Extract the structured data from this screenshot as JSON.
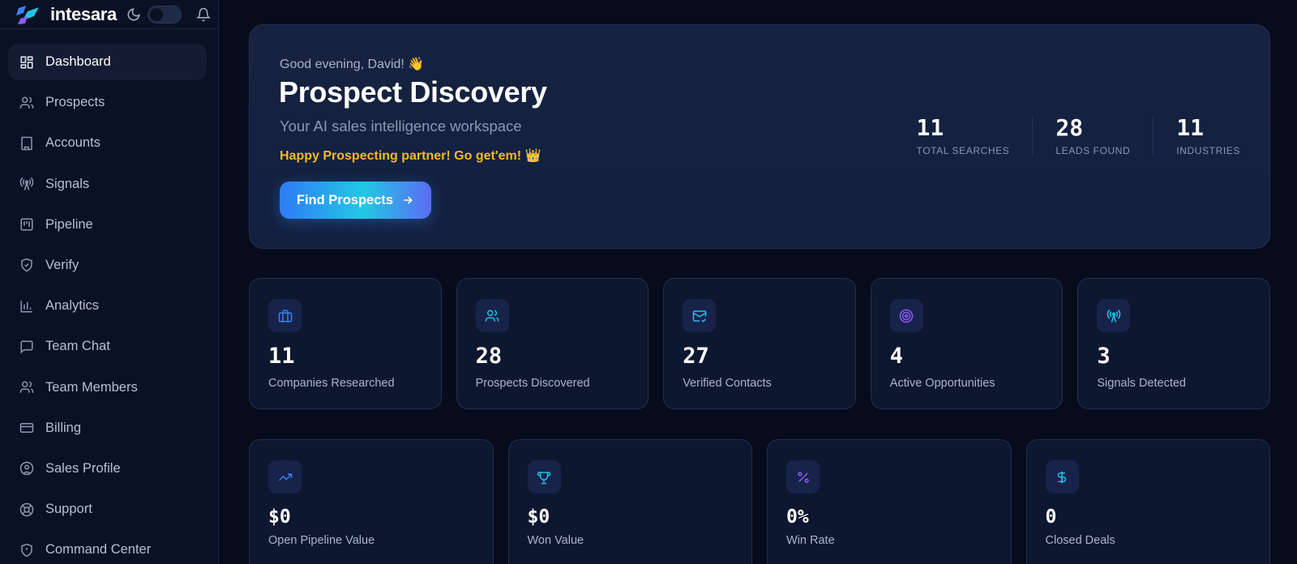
{
  "brand": {
    "name": "intesara"
  },
  "sidebar": {
    "items": [
      {
        "label": "Dashboard",
        "icon": "dashboard-icon",
        "active": true
      },
      {
        "label": "Prospects",
        "icon": "users-icon"
      },
      {
        "label": "Accounts",
        "icon": "building-icon"
      },
      {
        "label": "Signals",
        "icon": "radio-tower-icon"
      },
      {
        "label": "Pipeline",
        "icon": "kanban-icon"
      },
      {
        "label": "Verify",
        "icon": "shield-check-icon"
      },
      {
        "label": "Analytics",
        "icon": "bar-chart-icon"
      },
      {
        "label": "Team Chat",
        "icon": "message-icon"
      },
      {
        "label": "Team Members",
        "icon": "users-icon"
      },
      {
        "label": "Billing",
        "icon": "credit-card-icon"
      },
      {
        "label": "Sales Profile",
        "icon": "user-circle-icon"
      },
      {
        "label": "Support",
        "icon": "lifebuoy-icon"
      },
      {
        "label": "Command Center",
        "icon": "shield-alert-icon"
      }
    ]
  },
  "hero": {
    "greeting": "Good evening, David! 👋",
    "title": "Prospect Discovery",
    "subtitle": "Your AI sales intelligence workspace",
    "cta_text": "Happy Prospecting partner! Go get'em! 👑",
    "button_label": "Find Prospects",
    "stats": [
      {
        "value": "11",
        "caption": "TOTAL SEARCHES"
      },
      {
        "value": "28",
        "caption": "LEADS FOUND"
      },
      {
        "value": "11",
        "caption": "INDUSTRIES"
      }
    ]
  },
  "metrics_row1": [
    {
      "value": "11",
      "label": "Companies Researched",
      "icon": "briefcase-icon",
      "color": "#3b82f6"
    },
    {
      "value": "28",
      "label": "Prospects Discovered",
      "icon": "users-icon",
      "color": "#22c3e6"
    },
    {
      "value": "27",
      "label": "Verified Contacts",
      "icon": "mail-check-icon",
      "color": "#22c3e6"
    },
    {
      "value": "4",
      "label": "Active Opportunities",
      "icon": "target-icon",
      "color": "#8b5cf6"
    },
    {
      "value": "3",
      "label": "Signals Detected",
      "icon": "radio-tower-icon",
      "color": "#22c3e6"
    }
  ],
  "metrics_row2": [
    {
      "value": "$0",
      "label": "Open Pipeline Value",
      "icon": "trending-up-icon",
      "color": "#3b82f6"
    },
    {
      "value": "$0",
      "label": "Won Value",
      "icon": "trophy-icon",
      "color": "#22c3e6"
    },
    {
      "value": "0%",
      "label": "Win Rate",
      "icon": "percent-icon",
      "color": "#8b5cf6"
    },
    {
      "value": "0",
      "label": "Closed Deals",
      "icon": "dollar-icon",
      "color": "#22c3e6"
    }
  ]
}
